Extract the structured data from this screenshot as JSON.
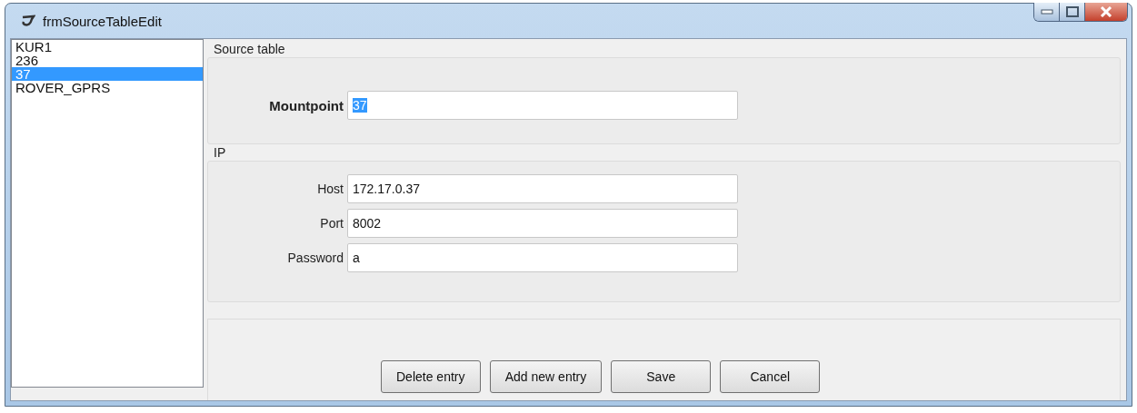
{
  "window": {
    "title": "frmSourceTableEdit"
  },
  "list": [
    {
      "label": "KUR1",
      "selected": false
    },
    {
      "label": "236",
      "selected": false
    },
    {
      "label": "37",
      "selected": true
    },
    {
      "label": "ROVER_GPRS",
      "selected": false
    }
  ],
  "source_table": {
    "title": "Source table",
    "mountpoint": {
      "label": "Mountpoint",
      "value": "37",
      "value_selected": true
    }
  },
  "ip": {
    "title": "IP",
    "fields": [
      {
        "label": "Host",
        "value": "172.17.0.37"
      },
      {
        "label": "Port",
        "value": "8002"
      },
      {
        "label": "Password",
        "value": "a"
      }
    ]
  },
  "buttons": [
    "Delete entry",
    "Add new entry",
    "Save",
    "Cancel"
  ]
}
